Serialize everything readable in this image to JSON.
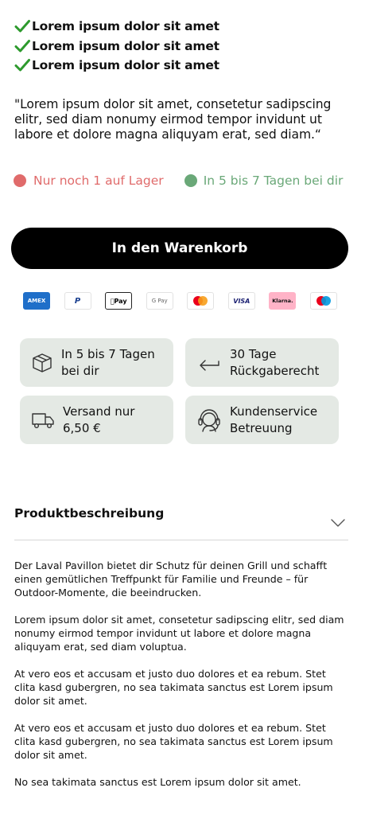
{
  "checklist": [
    "Lorem ipsum dolor sit amet",
    "Lorem ipsum dolor sit amet",
    "Lorem ipsum dolor sit amet"
  ],
  "quote": "\"Lorem ipsum dolor sit amet, consetetur sadipscing elitr, sed diam nonumy eirmod tempor invidunt ut labore et dolore magna aliquyam erat, sed diam.“",
  "stock": {
    "low_stock": "Nur noch 1 auf Lager",
    "delivery": "In 5 bis 7 Tagen bei dir",
    "colors": {
      "red": "#e06b6b",
      "green": "#6aa878"
    }
  },
  "cart_button": "In den Warenkorb",
  "payments": [
    {
      "icon": "amex-icon",
      "label": "AMEX"
    },
    {
      "icon": "paypal-icon",
      "label": "P"
    },
    {
      "icon": "apple-pay-icon",
      "label": "Pay"
    },
    {
      "icon": "google-pay-icon",
      "label": "G Pay"
    },
    {
      "icon": "mastercard-icon",
      "label": ""
    },
    {
      "icon": "visa-icon",
      "label": "VISA"
    },
    {
      "icon": "klarna-icon",
      "label": "Klarna."
    },
    {
      "icon": "maestro-icon",
      "label": ""
    }
  ],
  "features": [
    {
      "icon": "box-icon",
      "label": "In 5 bis 7 Tagen bei dir"
    },
    {
      "icon": "return-arrow-icon",
      "label": "30 Tage Rückgaberecht"
    },
    {
      "icon": "truck-icon",
      "label": "Versand nur 6,50 €"
    },
    {
      "icon": "headset-icon",
      "label": "Kundenservice Betreuung"
    }
  ],
  "description": {
    "title": "Produktbeschreibung",
    "paragraphs": [
      "Der Laval Pavillon bietet dir Schutz für deinen Grill und schafft  einen gemütlichen Treffpunkt für Familie und Freunde – für Outdoor-Momente, die beeindrucken.",
      "Lorem ipsum dolor sit amet, consetetur sadipscing elitr, sed diam nonumy eirmod tempor invidunt ut labore et dolore magna aliquyam erat, sed diam voluptua.",
      "At vero eos et accusam et justo duo dolores et ea rebum. Stet clita kasd gubergren, no sea takimata sanctus est Lorem ipsum dolor sit amet.",
      "At vero eos et accusam et justo duo dolores et ea rebum. Stet clita kasd gubergren, no sea takimata sanctus est Lorem ipsum dolor sit amet.",
      "No sea takimata sanctus est  Lorem ipsum dolor sit amet."
    ]
  }
}
